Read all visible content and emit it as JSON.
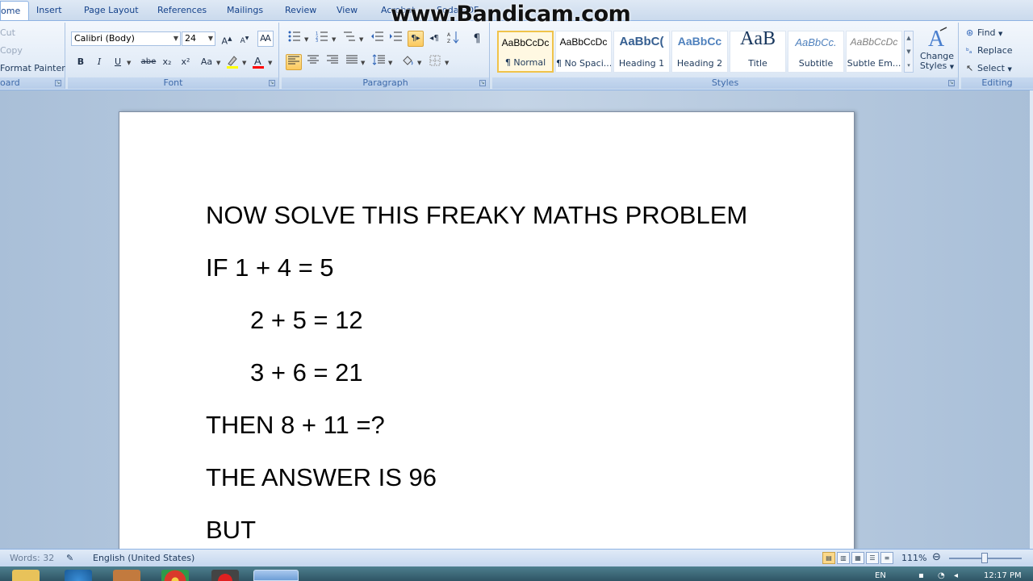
{
  "tabs": [
    "ome",
    "Insert",
    "Page Layout",
    "References",
    "Mailings",
    "Review",
    "View",
    "Acrobat",
    "Soda PDF"
  ],
  "clipboard": {
    "items": [
      "Cut",
      "Copy",
      "Format Painter"
    ],
    "group_label": "oard"
  },
  "font": {
    "name": "Calibri (Body)",
    "size": "24",
    "group_label": "Font",
    "buttons": [
      "B",
      "I",
      "U",
      "abe",
      "x₂",
      "x²",
      "Aa"
    ]
  },
  "paragraph": {
    "group_label": "Paragraph"
  },
  "styles": {
    "group_label": "Styles",
    "items": [
      {
        "sample": "AaBbCcDc",
        "name": "¶ Normal"
      },
      {
        "sample": "AaBbCcDc",
        "name": "¶ No Spaci..."
      },
      {
        "sample": "AaBbC(",
        "name": "Heading 1"
      },
      {
        "sample": "AaBbCc",
        "name": "Heading 2"
      },
      {
        "sample": "AaB",
        "name": "Title"
      },
      {
        "sample": "AaBbCc.",
        "name": "Subtitle"
      },
      {
        "sample": "AaBbCcDc",
        "name": "Subtle Em..."
      }
    ],
    "change_styles_line1": "Change",
    "change_styles_line2": "Styles"
  },
  "editing": {
    "group_label": "Editing",
    "find": "Find",
    "replace": "Replace",
    "select": "Select"
  },
  "document": {
    "lines": [
      "NOW SOLVE THIS FREAKY MATHS PROBLEM",
      "IF 1 + 4 = 5",
      "2 + 5 = 12",
      "3 + 6 = 21",
      "THEN 8 + 11 =?",
      "THE ANSWER IS 96",
      "BUT"
    ]
  },
  "watermark": "www.Bandicam.com",
  "statusbar": {
    "words": "Words: 32",
    "language": "English (United States)",
    "zoom": "111%",
    "zoom_level_percent": 111
  },
  "taskbar": {
    "lang": "EN",
    "time": "12:17 PM"
  },
  "colors": {
    "ribbon_text": "#15428b",
    "selection_highlight": "#fbc95e",
    "page": "#ffffff"
  }
}
